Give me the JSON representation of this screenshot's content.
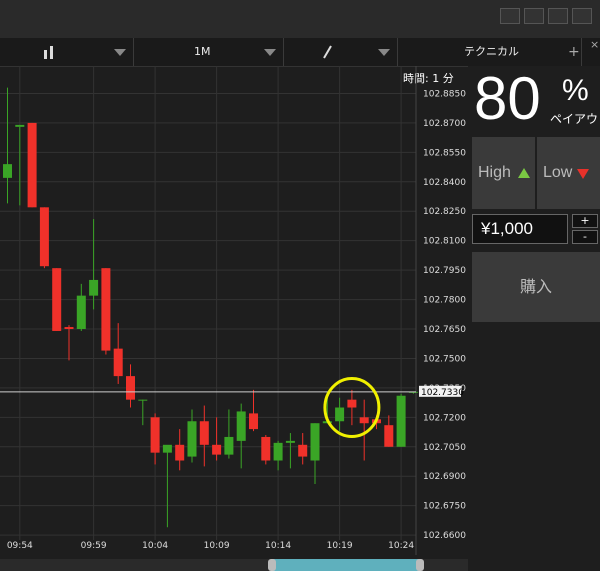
{
  "toolbar": {
    "chart_type_icon": "candlestick-bars-icon",
    "timeframe": "1M",
    "draw_icon": "pen-icon",
    "indicators_label": "テクニカル",
    "add_label": "+",
    "close_label": "×"
  },
  "chart": {
    "time_label": "時間: 1 分",
    "price_ticks": [
      "102.8850",
      "102.8700",
      "102.8550",
      "102.8400",
      "102.8250",
      "102.8100",
      "102.7950",
      "102.7800",
      "102.7650",
      "102.7500",
      "102.7350",
      "102.7200",
      "102.7050",
      "102.6900",
      "102.6750",
      "102.6600"
    ],
    "time_ticks": [
      "09:54",
      "09:59",
      "10:04",
      "10:09",
      "10:14",
      "10:19",
      "10:24"
    ],
    "current_price": "102.7330"
  },
  "chart_data": {
    "type": "candlestick",
    "ylim": [
      102.6575,
      102.899
    ],
    "up_color": "#3aa526",
    "down_color": "#f0312a",
    "candles": [
      {
        "o": 102.842,
        "h": 102.888,
        "l": 102.829,
        "c": 102.849
      },
      {
        "o": 102.868,
        "h": 102.868,
        "l": 102.828,
        "c": 102.869
      },
      {
        "o": 102.87,
        "h": 102.87,
        "l": 102.827,
        "c": 102.827
      },
      {
        "o": 102.827,
        "h": 102.827,
        "l": 102.796,
        "c": 102.797
      },
      {
        "o": 102.796,
        "h": 102.796,
        "l": 102.764,
        "c": 102.764
      },
      {
        "o": 102.766,
        "h": 102.767,
        "l": 102.749,
        "c": 102.765
      },
      {
        "o": 102.765,
        "h": 102.788,
        "l": 102.764,
        "c": 102.782
      },
      {
        "o": 102.782,
        "h": 102.821,
        "l": 102.775,
        "c": 102.79
      },
      {
        "o": 102.796,
        "h": 102.796,
        "l": 102.752,
        "c": 102.754
      },
      {
        "o": 102.755,
        "h": 102.768,
        "l": 102.737,
        "c": 102.741
      },
      {
        "o": 102.741,
        "h": 102.747,
        "l": 102.725,
        "c": 102.729
      },
      {
        "o": 102.729,
        "h": 102.729,
        "l": 102.716,
        "c": 102.729
      },
      {
        "o": 102.72,
        "h": 102.722,
        "l": 102.696,
        "c": 102.702
      },
      {
        "o": 102.702,
        "h": 102.705,
        "l": 102.664,
        "c": 102.706
      },
      {
        "o": 102.706,
        "h": 102.714,
        "l": 102.693,
        "c": 102.698
      },
      {
        "o": 102.7,
        "h": 102.724,
        "l": 102.697,
        "c": 102.718
      },
      {
        "o": 102.718,
        "h": 102.726,
        "l": 102.695,
        "c": 102.706
      },
      {
        "o": 102.706,
        "h": 102.72,
        "l": 102.698,
        "c": 102.701
      },
      {
        "o": 102.701,
        "h": 102.724,
        "l": 102.699,
        "c": 102.71
      },
      {
        "o": 102.708,
        "h": 102.727,
        "l": 102.694,
        "c": 102.723
      },
      {
        "o": 102.722,
        "h": 102.734,
        "l": 102.713,
        "c": 102.714
      },
      {
        "o": 102.71,
        "h": 102.711,
        "l": 102.696,
        "c": 102.698
      },
      {
        "o": 102.698,
        "h": 102.708,
        "l": 102.693,
        "c": 102.707
      },
      {
        "o": 102.707,
        "h": 102.712,
        "l": 102.694,
        "c": 102.708
      },
      {
        "o": 102.706,
        "h": 102.712,
        "l": 102.696,
        "c": 102.7
      },
      {
        "o": 102.698,
        "h": 102.717,
        "l": 102.686,
        "c": 102.717
      },
      {
        "o": 102.717,
        "h": 102.733,
        "l": 102.717,
        "c": 102.718
      },
      {
        "o": 102.718,
        "h": 102.73,
        "l": 102.713,
        "c": 102.725
      },
      {
        "o": 102.729,
        "h": 102.734,
        "l": 102.716,
        "c": 102.725
      },
      {
        "o": 102.72,
        "h": 102.729,
        "l": 102.698,
        "c": 102.717
      },
      {
        "o": 102.719,
        "h": 102.721,
        "l": 102.714,
        "c": 102.717
      },
      {
        "o": 102.716,
        "h": 102.721,
        "l": 102.705,
        "c": 102.705
      },
      {
        "o": 102.705,
        "h": 102.732,
        "l": 102.705,
        "c": 102.731
      },
      {
        "o": 102.733,
        "h": 102.733,
        "l": 102.732,
        "c": 102.733
      }
    ],
    "highlight": {
      "time_index": 28,
      "price": 102.725
    }
  },
  "trade": {
    "payout_value": "80",
    "payout_unit": "%",
    "payout_label": "ペイアウト",
    "high_label": "High",
    "low_label": "Low",
    "amount": "¥1,000",
    "increment": "+",
    "decrement": "-",
    "buy_label": "購入"
  }
}
